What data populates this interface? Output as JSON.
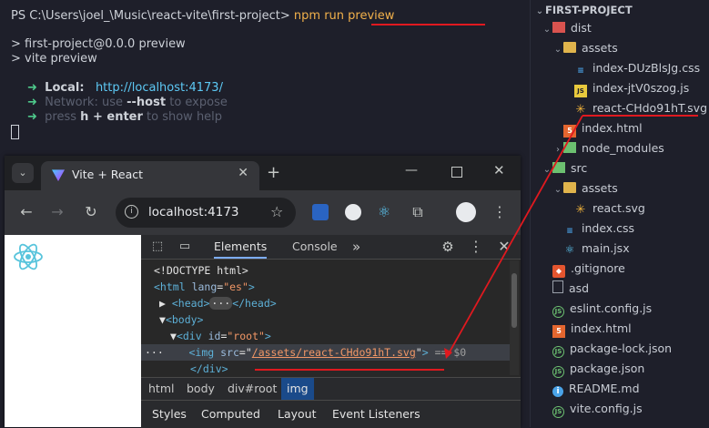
{
  "terminal": {
    "prompt": "PS C:\\Users\\joel_\\Music\\react-vite\\first-project>",
    "command": "npm run preview",
    "out1": "> first-project@0.0.0 preview",
    "out2": "> vite preview",
    "arrow": "➜",
    "local_label": "Local:",
    "local_url": "http://localhost:4173/",
    "network_label": "Network:",
    "network_use": "use",
    "network_flag": "--host",
    "network_rest": "to expose",
    "help_press": "press",
    "help_keys": "h + enter",
    "help_rest": "to show help"
  },
  "explorer": {
    "root": "FIRST-PROJECT",
    "items": [
      {
        "label": "dist",
        "type": "folder-red"
      },
      {
        "label": "assets",
        "type": "folder"
      },
      {
        "label": "index-DUzBlsJg.css",
        "type": "css"
      },
      {
        "label": "index-jtV0szog.js",
        "type": "js"
      },
      {
        "label": "react-CHdo91hT.svg",
        "type": "svg"
      },
      {
        "label": "index.html",
        "type": "html"
      },
      {
        "label": "node_modules",
        "type": "folder-green"
      },
      {
        "label": "src",
        "type": "folder-green"
      },
      {
        "label": "assets",
        "type": "folder"
      },
      {
        "label": "react.svg",
        "type": "svg"
      },
      {
        "label": "index.css",
        "type": "css"
      },
      {
        "label": "main.jsx",
        "type": "react"
      },
      {
        "label": ".gitignore",
        "type": "git"
      },
      {
        "label": "asd",
        "type": "file"
      },
      {
        "label": "eslint.config.js",
        "type": "js-cfg"
      },
      {
        "label": "index.html",
        "type": "html"
      },
      {
        "label": "package-lock.json",
        "type": "json"
      },
      {
        "label": "package.json",
        "type": "json"
      },
      {
        "label": "README.md",
        "type": "info"
      },
      {
        "label": "vite.config.js",
        "type": "js-cfg"
      }
    ]
  },
  "browser": {
    "tab_title": "Vite + React",
    "new_tab": "+",
    "address": "localhost:4173",
    "devtools": {
      "tabs": [
        "Elements",
        "Console"
      ],
      "more": "»",
      "dom": {
        "doctype": "<!DOCTYPE html>",
        "html_open": "<html",
        "lang_attr": "lang",
        "lang_val": "\"es\"",
        "head": "<head>",
        "head_ellipsis": "···",
        "head_close": "</head>",
        "body_open": "<body>",
        "div_open": "<div",
        "id_attr": "id",
        "id_val": "\"root\"",
        "img_open": "<img",
        "src_attr": "src",
        "src_val": "/assets/react-CHdo91hT.svg",
        "img_eq": "== $0",
        "div_close": "</div>"
      },
      "breadcrumbs": [
        "html",
        "body",
        "div#root",
        "img"
      ],
      "style_tabs": [
        "Styles",
        "Computed",
        "Layout",
        "Event Listeners"
      ]
    }
  },
  "colors": {
    "annotation": "#e0191f",
    "accent": "#5dc9f5"
  }
}
